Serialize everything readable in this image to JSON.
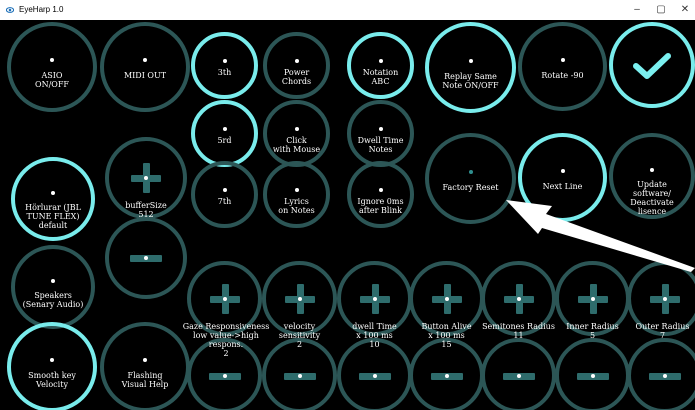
{
  "titlebar": {
    "title": "EyeHarp 1.0",
    "minimize_glyph": "–",
    "maximize_glyph": "▢",
    "close_glyph": "✕"
  },
  "buttons": {
    "asio": "ASIO\nON/OFF",
    "midi_out": "MIDI OUT",
    "third": "3th",
    "power_chords": "Power\nChords",
    "notation_abc": "Notation\nABC",
    "replay_same_note": "Replay Same\nNote ON/OFF",
    "rotate": "Rotate -90",
    "fifth": "5rd",
    "click_with_mouse": "Click\nwith Mouse",
    "dwell_time_notes": "Dwell Time\nNotes",
    "seventh": "7th",
    "lyrics_on_notes": "Lyrics\non Notes",
    "ignore_0ms": "Ignore 0ms\nafter Blink",
    "factory_reset": "Factory Reset",
    "next_line": "Next Line",
    "update_software": "Update software/\nDeactivate lisence",
    "horlurar": "Hörlurar (JBL\nTUNE FLEX) default",
    "buffer_size": "bufferSize\n512",
    "speakers": "Speakers\n(Senary Audio)",
    "smooth_key_velocity": "Smooth key\nVelocity",
    "flashing_visual_help": "Flashing\nVisual Help"
  },
  "sliders": {
    "gaze": "Gaze Responsiveness\nlow value->high respons.\n2",
    "velocity": "velocity\nsensitivity\n2",
    "dwell": "dwell Time\nx 100 ms\n10",
    "button_alive": "Button Alive\nx 100 ms\n15",
    "semitones": "Semitones Radius\n11",
    "inner_radius": "Inner Radius\n5",
    "outer_radius": "Outer Radius\n7"
  },
  "colors": {
    "ring": "#2c5656",
    "ring_active": "#79ecec",
    "plus_minus": "#2e6c6c",
    "background": "#000000"
  }
}
